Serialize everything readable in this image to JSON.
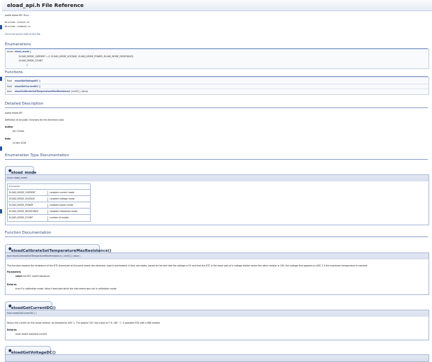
{
  "header": {
    "title": "eload_api.h File Reference"
  },
  "intro": {
    "brief": "public eload API.",
    "more": "More...",
    "includes": [
      "#include <stdint.h>",
      "#include <stdbool.h>"
    ],
    "source_link": "Go to the source code of this file."
  },
  "enumerations": {
    "heading": "Enumerations",
    "type": "enum",
    "name": "eload_mode",
    "open": "{",
    "line1": "ELOAD_MODE_CURRENT = 0, ELOAD_MODE_VOLTAGE, ELOAD_MODE_POWER, ELOAD_MODE_RESISTANCE,",
    "line2": "ELOAD_MODE_COUNT",
    "close": "}"
  },
  "functions": {
    "heading": "Functions",
    "items": [
      {
        "type": "float",
        "name": "eloadGetVoltageDC",
        "args": "()"
      },
      {
        "type": "float",
        "name": "eloadGetCurrentDC",
        "args": "()"
      },
      {
        "type": "bool",
        "name": "eloadCalibrateSetTemperatureMaxResistance",
        "args": "(uint32_t value)"
      }
    ]
  },
  "detailed": {
    "heading": "Detailed Description",
    "line1": "public eload API.",
    "line2": "Definition of all public functions for the electronic load.",
    "author_label": "Author",
    "author": "Jan Cumps",
    "date_label": "Date",
    "date": "24 dec 2016"
  },
  "enum_doc": {
    "heading": "Enumeration Type Documentation",
    "tab": "eload_mode",
    "proto": "enum eload_mode",
    "caption": "Enumerator",
    "rows": [
      {
        "key": "ELOAD_MODE_CURRENT",
        "desc": "constant current mode"
      },
      {
        "key": "ELOAD_MODE_VOLTAGE",
        "desc": "constant voltage mode"
      },
      {
        "key": "ELOAD_MODE_POWER",
        "desc": "constant power mode"
      },
      {
        "key": "ELOAD_MODE_RESISTANCE",
        "desc": "constant resistance mode"
      },
      {
        "key": "ELOAD_MODE_COUNT",
        "desc": "number of modes"
      }
    ]
  },
  "func_doc": {
    "heading": "Function Documentation",
    "f1": {
      "tab": "eloadCalibrateSetTemperatureMaxResistance()",
      "proto": "bool eloadCalibrateSetTemperatureMaxResistance ( uint32_t  value )",
      "desc": "This function expects the resistance of the NTC thermistor at the point where the electronic load is overheated. It then calculates, based on the fact that the voltage is 5V and that the NTC is the lower part of a voltage divider where the other resistor is 10K, the voltage that appears on ADC 3 if the maximum temperature is reached",
      "params_label": "Parameters",
      "param_name": "value",
      "param_desc": "the NTC cutoff resistance",
      "returns_label": "Returns",
      "returns": "true if in calibration mode. false if executed while the instrument was not in calibration mode"
    },
    "f2": {
      "tab": "eloadGetCurrentDC()",
      "proto": "float eloadGetCurrentDC ( )",
      "desc": "Return the current on the sense resistor, as sampled by ADC 1. The opamp U3C has a gain of 7.6, LSB ~1 .5 populate R32 with a 68K resistor",
      "returns_label": "Returns",
      "returns": "most recent sampled current"
    },
    "f3": {
      "tab": "eloadGetVoltageDC()"
    }
  }
}
